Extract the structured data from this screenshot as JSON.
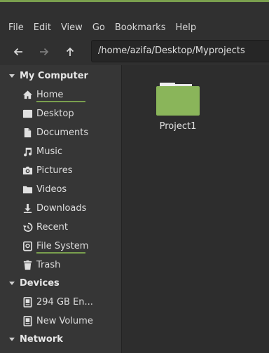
{
  "menu": [
    "File",
    "Edit",
    "View",
    "Go",
    "Bookmarks",
    "Help"
  ],
  "location": "/home/azifa/Desktop/Myprojects",
  "sidebar": {
    "sections": [
      {
        "title": "My Computer",
        "items": [
          {
            "label": "Home",
            "icon": "home-icon",
            "usage": 0.5
          },
          {
            "label": "Desktop",
            "icon": "desktop-icon"
          },
          {
            "label": "Documents",
            "icon": "document-icon"
          },
          {
            "label": "Music",
            "icon": "music-icon"
          },
          {
            "label": "Pictures",
            "icon": "camera-icon"
          },
          {
            "label": "Videos",
            "icon": "folder-icon"
          },
          {
            "label": "Downloads",
            "icon": "download-icon"
          },
          {
            "label": "Recent",
            "icon": "recent-icon"
          },
          {
            "label": "File System",
            "icon": "drive-icon",
            "usage": 0.5
          },
          {
            "label": "Trash",
            "icon": "trash-icon"
          }
        ]
      },
      {
        "title": "Devices",
        "items": [
          {
            "label": "294 GB En...",
            "icon": "disk-icon"
          },
          {
            "label": "New Volume",
            "icon": "disk-icon"
          }
        ]
      },
      {
        "title": "Network",
        "items": []
      }
    ]
  },
  "files": [
    {
      "name": "Project1",
      "icon": "folder-icon"
    }
  ],
  "colors": {
    "accent": "#7a9f4e",
    "folder": "#8ab55a"
  }
}
